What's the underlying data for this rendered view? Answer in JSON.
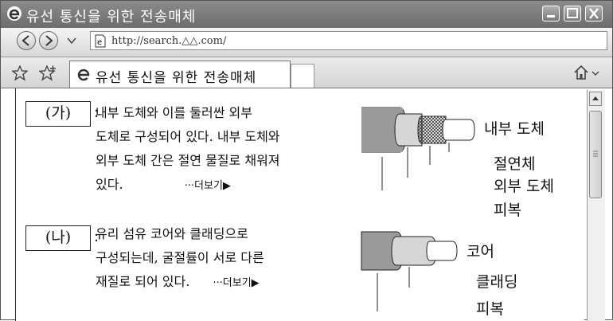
{
  "window": {
    "title": "유선 통신을 위한 전송매체"
  },
  "address_bar": {
    "url": "http://search.△△.com/"
  },
  "tab": {
    "title": "유선 통신을 위한 전송매체"
  },
  "items": [
    {
      "label": "(가)",
      "lines": [
        "내부 도체와 이를 둘러싼 외부",
        "도체로 구성되어 있다. 내부 도체와",
        "외부 도체 간은 절연 물질로 채워져",
        "있다."
      ],
      "more": "···더보기▶",
      "diagram_labels": [
        "내부 도체",
        "절연체",
        "외부 도체",
        "피복"
      ]
    },
    {
      "label": "(나)",
      "lines": [
        "유리 섬유 코어와 클래딩으로",
        "구성되는데, 굴절률이 서로 다른",
        "재질로 되어 있다."
      ],
      "more": "···더보기▶",
      "diagram_labels": [
        "코어",
        "클래딩",
        "피복"
      ]
    }
  ]
}
